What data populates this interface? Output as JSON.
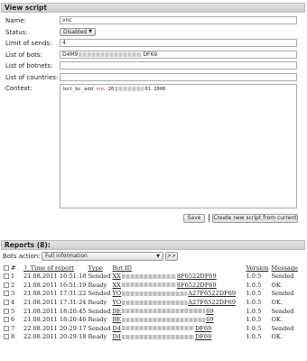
{
  "view": {
    "title": "View script",
    "labels": {
      "name": "Name:",
      "status": "Status:",
      "limit": "Limit of sends:",
      "bots": "List of bots:",
      "botnets": "List of botnets:",
      "countries": "List of countries:",
      "context": "Context:"
    },
    "name_value": "vnc",
    "status_value": "Disabled",
    "limit_value": "4",
    "bots_prefix": "D4M9",
    "bots_suffix": "DF69",
    "botnets_value": "",
    "countries_value": "",
    "context_prefix": "bot_bc_add ",
    "context_red": "vnc",
    "context_mid": " 20",
    "context_end": "01  2006",
    "save_label": "Save",
    "new_script_label": "Create new script from current"
  },
  "reports": {
    "title": "Reports (8):",
    "bots_action_label": "Bots action:",
    "action_value": "Full information",
    "go_label": ">>",
    "columns": [
      "#",
      "Time of report",
      "Type",
      "Bot ID",
      "Version",
      "Message"
    ],
    "rows": [
      {
        "n": "1",
        "time": "21.08.2011 16:51:18",
        "type": "Sended",
        "bot_pre": "XX",
        "bot_suf": "8F6522DF69",
        "version": "1.0.5",
        "message": "Sended"
      },
      {
        "n": "2",
        "time": "21.08.2011 16:51:19",
        "type": "Ready",
        "bot_pre": "XX",
        "bot_suf": "8F6522DF69",
        "version": "1.0.5",
        "message": "OK."
      },
      {
        "n": "3",
        "time": "21.08.2011 17:31:22",
        "type": "Sended",
        "bot_pre": "YO",
        "bot_suf": "A27F6522DF69",
        "version": "1.0.5",
        "message": "Sended"
      },
      {
        "n": "4",
        "time": "21.08.2011 17:31:24",
        "type": "Ready",
        "bot_pre": "YO",
        "bot_suf": "A27F6522DF69",
        "version": "1.0.5",
        "message": "OK."
      },
      {
        "n": "5",
        "time": "21.08.2011 18:20:45",
        "type": "Sended",
        "bot_pre": "BE",
        "bot_suf": "69",
        "version": "1.0.5",
        "message": "Sended"
      },
      {
        "n": "6",
        "time": "21.08.2011 18:20:46",
        "type": "Ready",
        "bot_pre": "BE",
        "bot_suf": "69",
        "version": "1.0.5",
        "message": "OK."
      },
      {
        "n": "7",
        "time": "22.08.2011 20:29:17",
        "type": "Sended",
        "bot_pre": "D4",
        "bot_suf": "DF69",
        "version": "1.0.5",
        "message": "Sended"
      },
      {
        "n": "8",
        "time": "22.08.2011 20:29:18",
        "type": "Ready",
        "bot_pre": "D4",
        "bot_suf": "DF69",
        "version": "1.0.5",
        "message": "OK."
      }
    ]
  }
}
